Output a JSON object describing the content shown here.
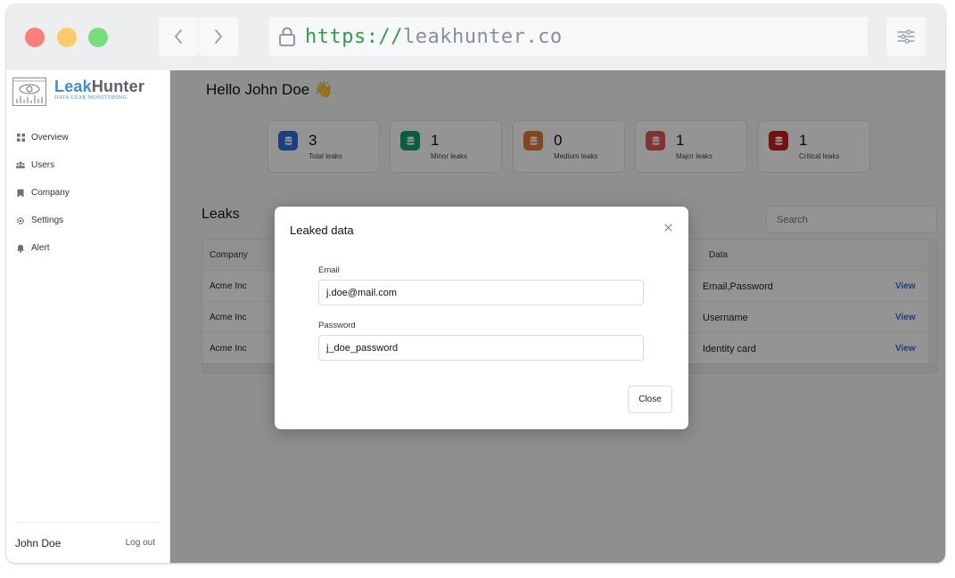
{
  "browser": {
    "url_scheme": "https://",
    "url_host": "leakhunter.co"
  },
  "logo": {
    "title_part1": "Leak",
    "title_part2": "Hunter",
    "subtitle": "DATA LEAK MONITORING"
  },
  "sidebar": {
    "items": [
      {
        "label": "Overview",
        "icon": "grid-icon"
      },
      {
        "label": "Users",
        "icon": "users-icon"
      },
      {
        "label": "Company",
        "icon": "building-icon"
      },
      {
        "label": "Settings",
        "icon": "gear-icon"
      },
      {
        "label": "Alert",
        "icon": "bell-icon"
      }
    ],
    "user_name": "John Doe",
    "logout_label": "Log out"
  },
  "header": {
    "greeting": "Hello John Doe 👋"
  },
  "stats": [
    {
      "value": "3",
      "label": "Total leaks",
      "color": "#2f6fd9"
    },
    {
      "value": "1",
      "label": "Minor leaks",
      "color": "#0e9f6e"
    },
    {
      "value": "0",
      "label": "Medium leaks",
      "color": "#e07b39"
    },
    {
      "value": "1",
      "label": "Major leaks",
      "color": "#e15759"
    },
    {
      "value": "1",
      "label": "Critical leaks",
      "color": "#c81e1e"
    }
  ],
  "leaks": {
    "title": "Leaks",
    "search_placeholder": "Search",
    "columns": {
      "company": "Company",
      "data": "Data"
    },
    "rows": [
      {
        "company": "Acme Inc",
        "data": "Email,Password",
        "action": "View"
      },
      {
        "company": "Acme Inc",
        "data": "Username",
        "action": "View"
      },
      {
        "company": "Acme Inc",
        "data": "Identity card",
        "action": "View"
      }
    ]
  },
  "modal": {
    "title": "Leaked data",
    "email_label": "Email",
    "email_value": "j.doe@mail.com",
    "password_label": "Password",
    "password_value": "j_doe_password",
    "close_label": "Close"
  }
}
